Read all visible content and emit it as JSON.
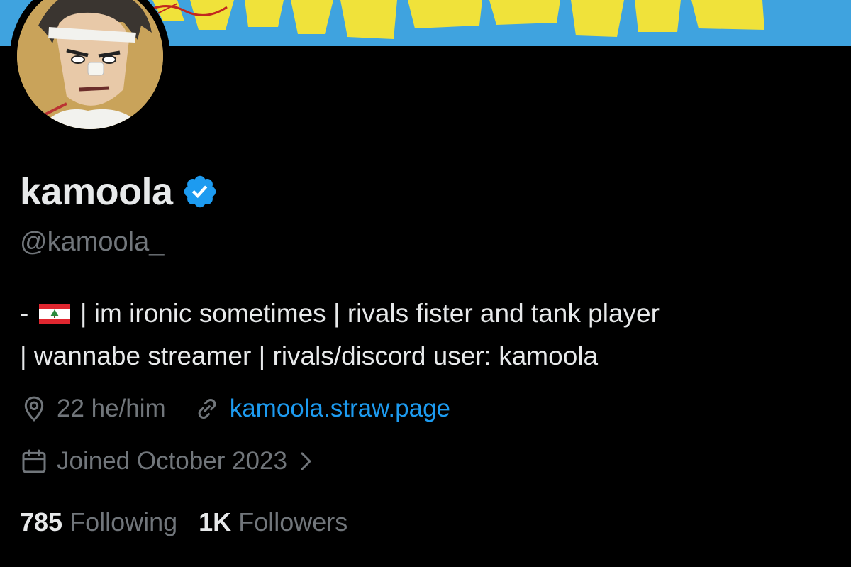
{
  "profile": {
    "display_name": "kamoola",
    "handle": "@kamoola_",
    "verified_icon": "verified-badge-icon",
    "bio_line1_prefix": "- ",
    "bio_flag": "lebanon-flag-icon",
    "bio_line1_rest": " | im ironic sometimes | rivals fister and tank player",
    "bio_line2": "| wannabe streamer | rivals/discord user: kamoola",
    "location": "22 he/him",
    "website": "kamoola.straw.page",
    "joined": "Joined October 2023"
  },
  "stats": {
    "following_count": "785",
    "following_label": "Following",
    "followers_count": "1K",
    "followers_label": "Followers"
  },
  "colors": {
    "background": "#000000",
    "primary_text": "#e7e9ea",
    "secondary_text": "#71767b",
    "link": "#1d9bf0",
    "banner": "#3fa3df"
  }
}
